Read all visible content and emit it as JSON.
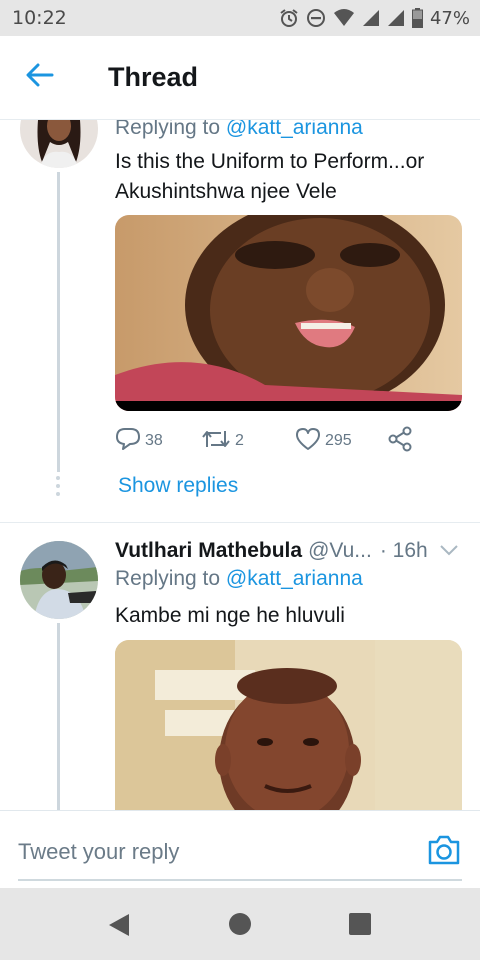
{
  "status_bar": {
    "time": "10:22",
    "battery": "47%",
    "icons": [
      "alarm-icon",
      "do-not-disturb-icon",
      "wifi-icon",
      "signal-icon",
      "signal-icon",
      "battery-icon"
    ]
  },
  "header": {
    "title": "Thread",
    "back_icon": "back-arrow-icon"
  },
  "tweets": [
    {
      "replying_prefix": "Replying to",
      "replying_to": "@katt_arianna",
      "text_line1": "Is this the Uniform to Perform...or",
      "text_line2": "Akushintshwa njee Vele",
      "actions": {
        "replies": "38",
        "retweets": "2",
        "likes": "295"
      },
      "show_replies": "Show replies"
    },
    {
      "name": "Vutlhari Mathebula",
      "handle": "@Vu...",
      "time": "· 16h",
      "replying_prefix": "Replying to",
      "replying_to": "@katt_arianna",
      "text": "Kambe mi nge he hluvuli"
    }
  ],
  "reply_bar": {
    "placeholder": "Tweet your reply",
    "camera_icon": "camera-icon"
  },
  "nav_bar": {
    "buttons": [
      "back-triangle-icon",
      "home-circle-icon",
      "recents-square-icon"
    ]
  },
  "colors": {
    "accent": "#1b95e0",
    "muted": "#657786",
    "text": "#14171a",
    "status_bar_bg": "#e6e6e6"
  }
}
